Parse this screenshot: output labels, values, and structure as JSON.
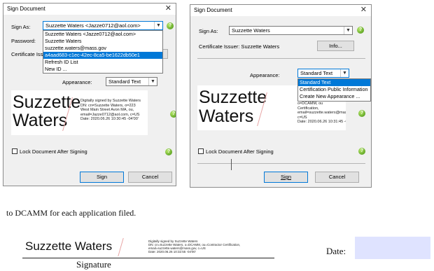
{
  "dialog1": {
    "title": "Sign Document",
    "close": "✕",
    "sign_as_label": "Sign As:",
    "sign_as_value": "Suzzette Waters <Jazze0712@aol.com>",
    "password_label": "Password:",
    "cert_issuer_label": "Certificate Issu",
    "dropdown_items": [
      "Suzzette Waters <Jazze0712@aol.com>",
      "Suzzette Waters",
      "suzzette.waters@mass.gov",
      "a4aad683-c1ec-42ec-8ca5-be1622db50e1",
      "Refresh ID List",
      "New ID ..."
    ],
    "appearance_label": "Appearance:",
    "appearance_value": "Standard Text",
    "signature": {
      "line1": "Suzzette",
      "line2": "Waters",
      "details": "Digitally signed by Suzzette Waters\nDN: cn=Suzzette Waters, o=223\nWest Main Street Avon MA, ou,\nemail=Jazze0712@aol.com, c=US\nDate: 2020.06.26 10:30:45 -04'00'"
    },
    "lock_label": "Lock Document After Signing",
    "sign_button": "Sign",
    "cancel_button": "Cancel"
  },
  "dialog2": {
    "title": "Sign Document",
    "close": "✕",
    "sign_as_label": "Sign As:",
    "sign_as_value": "Suzzette Waters",
    "cert_issuer_label": "Certificate Issuer: Suzzette Waters",
    "info_button": "Info...",
    "appearance_label": "Appearance:",
    "appearance_value": "Standard Text",
    "appearance_options": [
      "Standard Text",
      "Certification Public Information",
      "Create New Appearance ..."
    ],
    "signature": {
      "line1": "Suzzette",
      "line2": "Waters",
      "details": "Digitally signed by Suzze\nDN: cn=Suzze\no=DCAMM, ou\nCertification,\nemail=suzzette.waters@mass.gov,\nc=US\nDate: 2020.06.26 10:31:45 -04'00'"
    },
    "lock_label": "Lock Document After Signing",
    "sign_button": "Sign",
    "cancel_button": "Cancel"
  },
  "page": {
    "body_text": "to DCAMM for each application filed.",
    "signature_name": "Suzzette Waters",
    "signature_details": "Digitally signed by Suzzette Waters\nDN: cn=Suzzette Waters, o=DCAMM, ou=Contractor Certification,\nemail=suzzette.waters@mass.gov, c=US\nDate: 2020.06.26 10:32:55 -04'00'",
    "signature_caption": "Signature",
    "date_label": "Date:",
    "help_glyph": "?"
  },
  "colors": {
    "selection": "#0078d7",
    "date_field": "#dfe3ff",
    "help_icon": "#5aa81a"
  }
}
